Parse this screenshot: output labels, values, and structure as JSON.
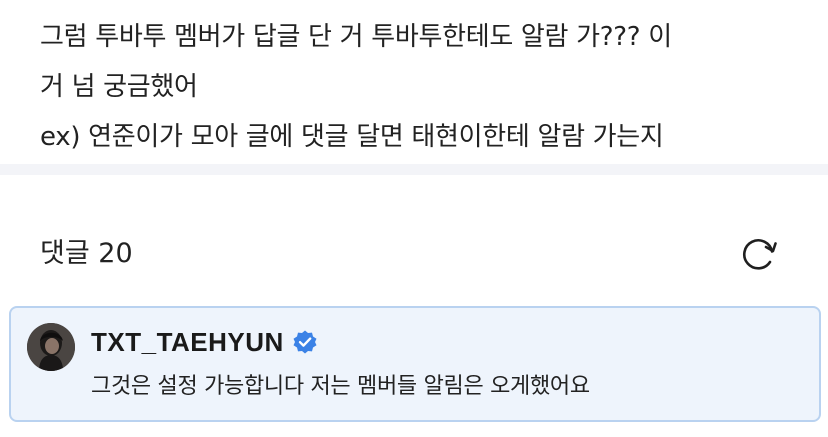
{
  "post": {
    "lines": [
      "그럼 투바투 멤버가 답글 단 거 투바투한테도 알람 가??? 이",
      "거 넘 궁금했어",
      "ex) 연준이가 모아 글에 댓글 달면 태현이한테 알람 가는지"
    ]
  },
  "comments": {
    "label": "댓글",
    "count": "20",
    "refresh_icon": "refresh-icon"
  },
  "highlighted_comment": {
    "author": "TXT_TAEHYUN",
    "verified_icon": "verified-badge-icon",
    "text": "그것은 설정 가능합니다 저는 멤버들 알림은 오게했어요",
    "accent_color": "#3b82e6",
    "card_bg": "#eef4fc"
  }
}
